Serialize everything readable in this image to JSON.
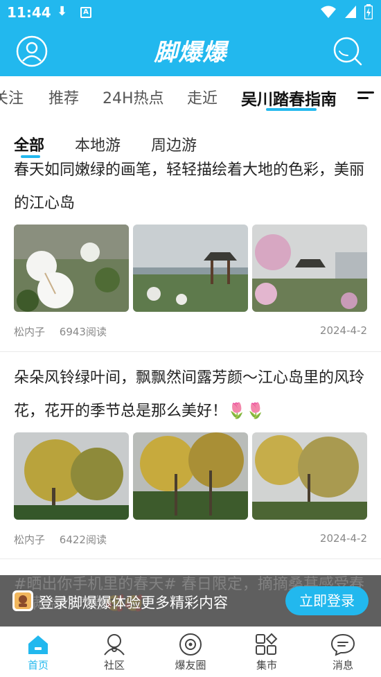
{
  "status_bar": {
    "time": "11:44",
    "download_glyph": "⬇",
    "badge_letter": "A"
  },
  "app_bar": {
    "logo_text": "脚爆爆",
    "accent_color": "#22b8ee"
  },
  "channels": {
    "tabs": [
      "关注",
      "推荐",
      "24H热点",
      "走近",
      "吴川踏春指南"
    ],
    "active_index": 4
  },
  "sub_tabs": {
    "tabs": [
      "全部",
      "本地游",
      "周边游"
    ],
    "active_index": 0
  },
  "posts": [
    {
      "title": "春天如同嫩绿的画笔，轻轻描绘着大地的色彩，美丽的江心岛",
      "author": "松内子",
      "reads": "6943阅读",
      "date": "2024-4-2"
    },
    {
      "title": "朵朵风铃绿叶间，飘飘然间露芳颜～江心岛里的风玲花，花开的季节总是那么美好！🌷🌷",
      "author": "松内子",
      "reads": "6422阅读",
      "date": "2024-4-2"
    },
    {
      "title": "#晒出你手机里的春天# 春日限定，摘摘桑葚感受春意满溢的气息🥰🥰"
    }
  ],
  "login_banner": {
    "text": "登录脚爆爆体验更多精彩内容",
    "button_label": "立即登录"
  },
  "bottom_nav": {
    "items": [
      "首页",
      "社区",
      "爆友圈",
      "集市",
      "消息"
    ],
    "active_index": 0
  }
}
